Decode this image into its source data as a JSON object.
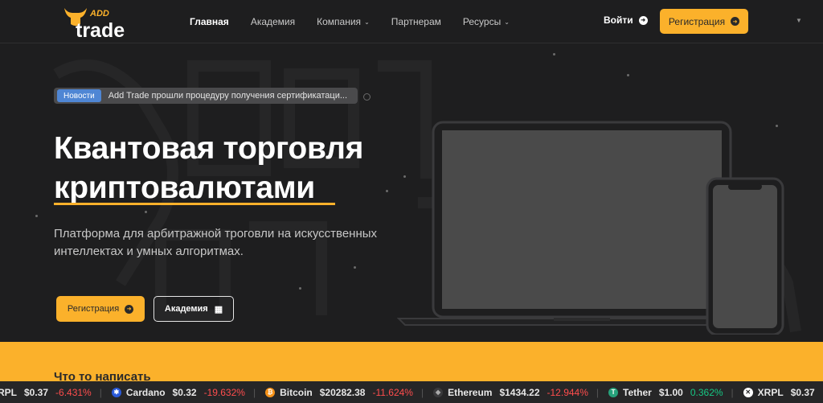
{
  "header": {
    "logo_top": "ADD",
    "logo_main": "trade",
    "nav": [
      {
        "label": "Главная",
        "active": true,
        "dropdown": false
      },
      {
        "label": "Академия",
        "active": false,
        "dropdown": false
      },
      {
        "label": "Компания",
        "active": false,
        "dropdown": true
      },
      {
        "label": "Партнерам",
        "active": false,
        "dropdown": false
      },
      {
        "label": "Ресурсы",
        "active": false,
        "dropdown": true
      }
    ],
    "login_label": "Войти",
    "register_label": "Регистрация"
  },
  "news": {
    "badge": "Новости",
    "text": "Add Trade прошли процедуру получения сертификатаци..."
  },
  "hero": {
    "title_line1": "Квантовая торговля",
    "title_line2": "криптовалютами",
    "subtitle": "Платформа для арбитражной троговли на искусственных интеллектах и умных алгоритмах.",
    "register_label": "Регистрация",
    "academy_label": "Академия"
  },
  "section": {
    "title": "Что то написать"
  },
  "ticker": [
    {
      "name": "RPL",
      "price": "$0.37",
      "change": "-6.431%",
      "trend": "neg",
      "icon": "xrp-icon",
      "color": "#ffffff"
    },
    {
      "name": "Cardano",
      "price": "$0.32",
      "change": "-19.632%",
      "trend": "neg",
      "icon": "cardano-icon",
      "color": "#2a5ada"
    },
    {
      "name": "Bitcoin",
      "price": "$20282.38",
      "change": "-11.624%",
      "trend": "neg",
      "icon": "bitcoin-icon",
      "color": "#f7931a"
    },
    {
      "name": "Ethereum",
      "price": "$1434.22",
      "change": "-12.944%",
      "trend": "neg",
      "icon": "ethereum-icon",
      "color": "#8c8c8c"
    },
    {
      "name": "Tether",
      "price": "$1.00",
      "change": "0.362%",
      "trend": "pos",
      "icon": "tether-icon",
      "color": "#26a17b"
    },
    {
      "name": "XRPL",
      "price": "$0.37",
      "change": "",
      "trend": "neg",
      "icon": "xrp-icon",
      "color": "#ffffff"
    }
  ],
  "colors": {
    "accent": "#fbb12b",
    "background": "#1e1e1f",
    "news_badge": "#4f86d4",
    "negative": "#ff4d4d",
    "positive": "#16c784"
  }
}
